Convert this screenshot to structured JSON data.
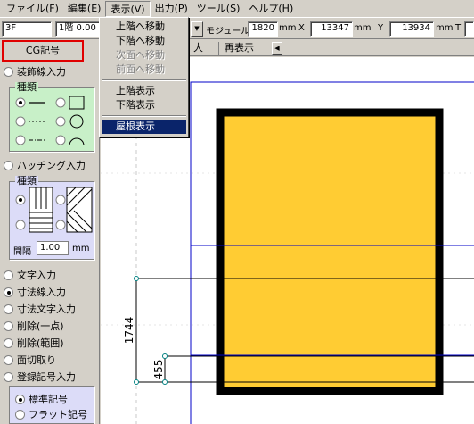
{
  "menubar": {
    "items": [
      {
        "label": "ファイル(F)"
      },
      {
        "label": "編集(E)"
      },
      {
        "label": "表示(V)"
      },
      {
        "label": "出力(P)"
      },
      {
        "label": "ツール(S)"
      },
      {
        "label": "ヘルプ(H)"
      }
    ]
  },
  "view_menu": {
    "items": [
      "上階へ移動",
      "下階へ移動",
      "次面へ移動",
      "前面へ移動",
      "上階表示",
      "下階表示",
      "屋根表示"
    ]
  },
  "toolbar": {
    "floor": "3F",
    "floor_sub": "1階 0.00",
    "module_label": "モジュール",
    "module_value": "1820",
    "unit_mm": "mm",
    "x_label": "X",
    "x_value": "13347",
    "y_label": "Y",
    "y_value": "13934",
    "t_label": "T"
  },
  "left_panel": {
    "cg_button": "CG記号",
    "decor_line_label": "装飾線入力",
    "types_title": "種類",
    "hatching_label": "ハッチング入力",
    "interval_label": "間隔",
    "interval_value": "1.00",
    "interval_unit": "mm",
    "options": [
      "文字入力",
      "寸法線入力",
      "寸法文字入力",
      "削除(一点)",
      "削除(範囲)",
      "面切取り",
      "登録記号入力"
    ],
    "symbol_options": [
      "標準記号",
      "フラット記号"
    ]
  },
  "tabs": {
    "tab1": "大",
    "tab2": "再表示"
  },
  "canvas": {
    "dim_long": "1744",
    "dim_short": "455",
    "room_color": "#FFCC33"
  }
}
